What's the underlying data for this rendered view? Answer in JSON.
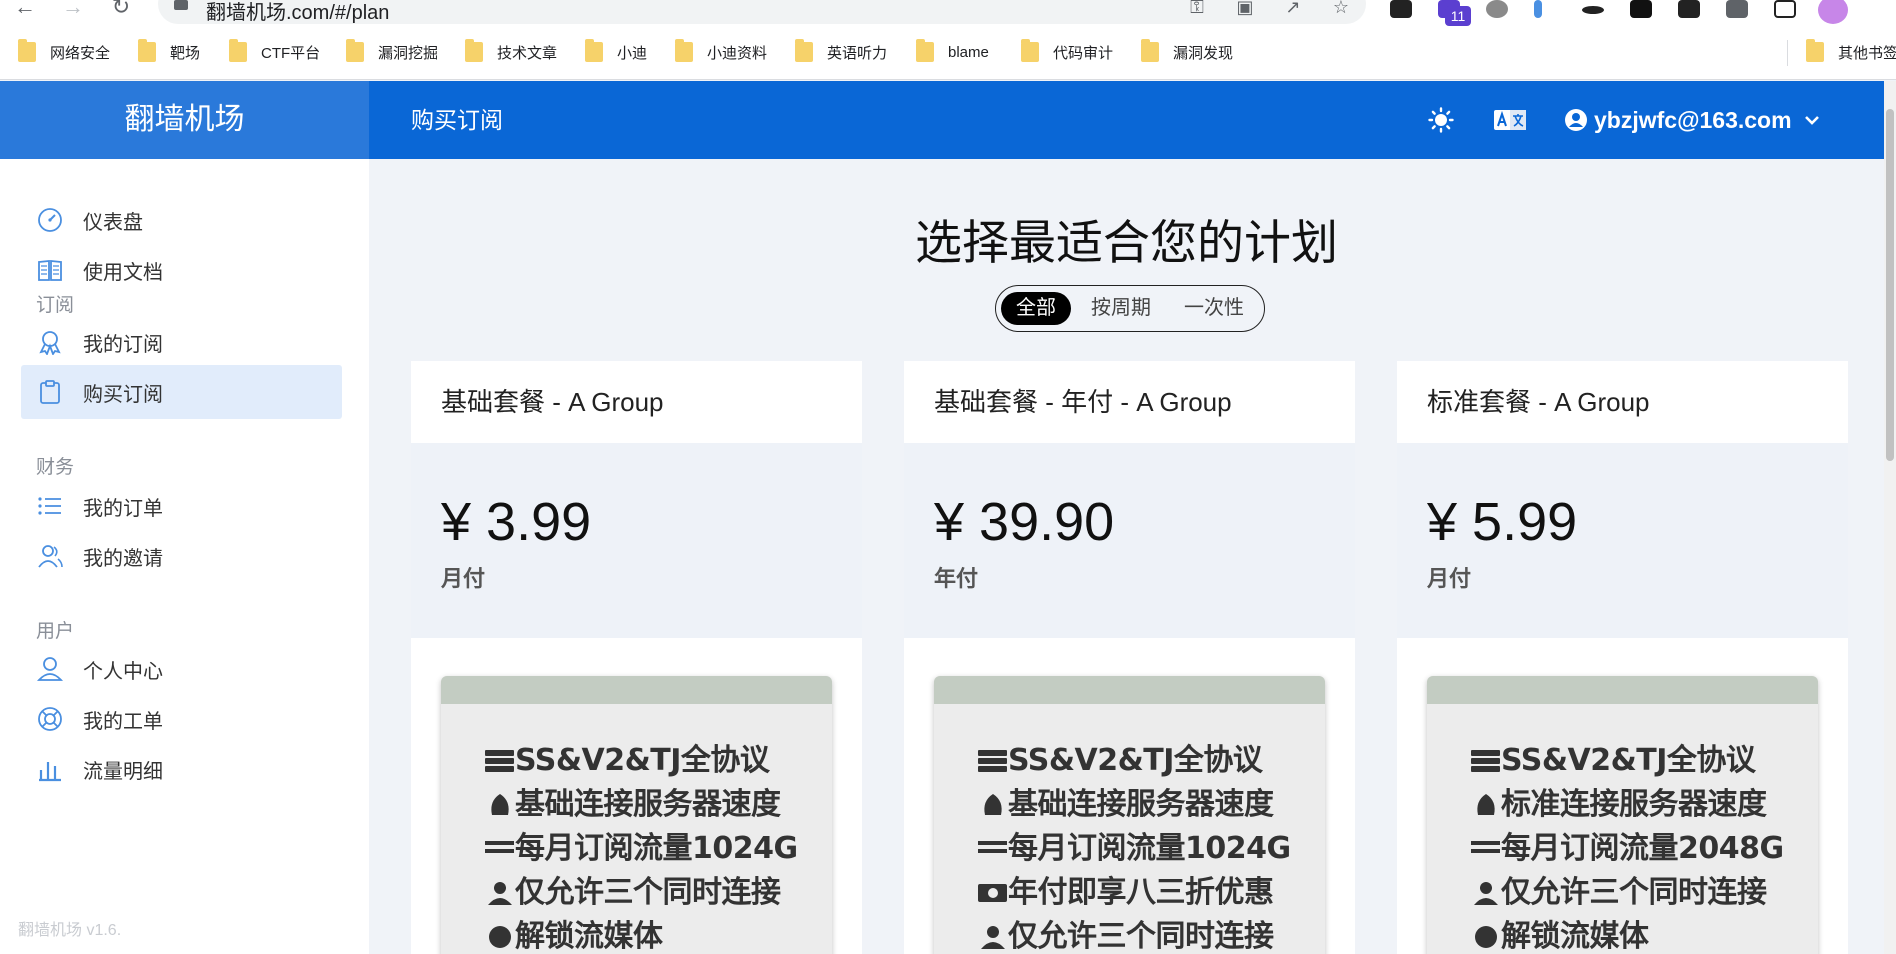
{
  "browser": {
    "url": "翻墙机场.com/#/plan",
    "extension_badge": "11",
    "bookmarks": [
      "网络安全",
      "靶场",
      "CTF平台",
      "漏洞挖掘",
      "技术文章",
      "小迪",
      "小迪资料",
      "英语听力",
      "blame",
      "代码审计",
      "漏洞发现"
    ],
    "other_bookmarks": "其他书签"
  },
  "app": {
    "brand": "翻墙机场",
    "page_title": "购买订阅",
    "user_email": "ybzjwfc@163.com",
    "accent_color": "#0a67d6"
  },
  "sidebar": {
    "top_items": [
      {
        "label": "仪表盘",
        "icon": "dashboard-icon"
      },
      {
        "label": "使用文档",
        "icon": "book-icon"
      }
    ],
    "sections": [
      {
        "heading": "订阅",
        "items": [
          {
            "label": "我的订阅",
            "icon": "award-icon"
          },
          {
            "label": "购买订阅",
            "icon": "clipboard-icon",
            "active": true
          }
        ]
      },
      {
        "heading": "财务",
        "items": [
          {
            "label": "我的订单",
            "icon": "list-icon"
          },
          {
            "label": "我的邀请",
            "icon": "users-icon"
          }
        ]
      },
      {
        "heading": "用户",
        "items": [
          {
            "label": "个人中心",
            "icon": "user-icon"
          },
          {
            "label": "我的工单",
            "icon": "lifebuoy-icon"
          },
          {
            "label": "流量明细",
            "icon": "bar-chart-icon"
          }
        ]
      }
    ],
    "footer": "翻墙机场 v1.6."
  },
  "main": {
    "heading": "选择最适合您的计划",
    "filters": [
      {
        "label": "全部",
        "active": true
      },
      {
        "label": "按周期",
        "active": false
      },
      {
        "label": "一次性",
        "active": false
      }
    ],
    "plans": [
      {
        "name": "基础套餐 - A Group",
        "price": "¥ 3.99",
        "period": "月付",
        "features": [
          {
            "icon": "server-icon",
            "text": "SS&V2&TJ全协议"
          },
          {
            "icon": "rocket-icon",
            "text": "基础连接服务器速度"
          },
          {
            "icon": "bars-icon",
            "text": "每月订阅流量1024G"
          },
          {
            "icon": "person-icon",
            "text": "仅允许三个同时连接"
          },
          {
            "icon": "globe-icon",
            "text": "解锁流媒体"
          }
        ]
      },
      {
        "name": "基础套餐 - 年付 - A Group",
        "price": "¥ 39.90",
        "period": "年付",
        "features": [
          {
            "icon": "server-icon",
            "text": "SS&V2&TJ全协议"
          },
          {
            "icon": "rocket-icon",
            "text": "基础连接服务器速度"
          },
          {
            "icon": "bars-icon",
            "text": "每月订阅流量1024G"
          },
          {
            "icon": "money-icon",
            "text": "年付即享八三折优惠"
          },
          {
            "icon": "person-icon",
            "text": "仅允许三个同时连接"
          }
        ]
      },
      {
        "name": "标准套餐 - A Group",
        "price": "¥ 5.99",
        "period": "月付",
        "features": [
          {
            "icon": "server-icon",
            "text": "SS&V2&TJ全协议"
          },
          {
            "icon": "rocket-icon",
            "text": "标准连接服务器速度"
          },
          {
            "icon": "bars-icon",
            "text": "每月订阅流量2048G"
          },
          {
            "icon": "person-icon",
            "text": "仅允许三个同时连接"
          },
          {
            "icon": "globe-icon",
            "text": "解锁流媒体"
          }
        ]
      }
    ]
  }
}
